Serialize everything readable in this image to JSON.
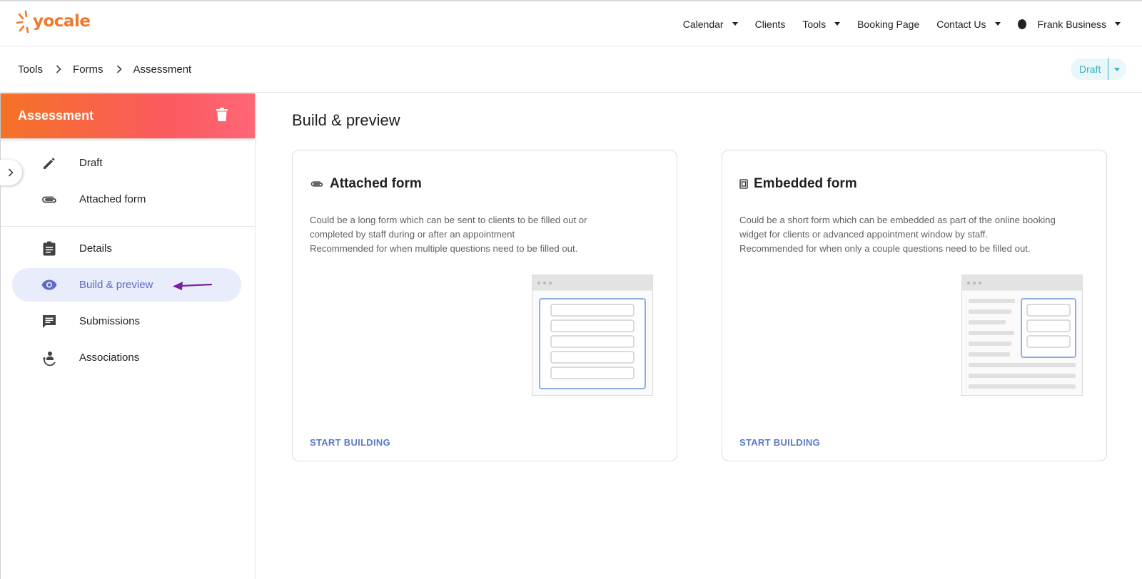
{
  "brand": {
    "name": "yocale",
    "color": "#f0782b"
  },
  "nav": {
    "items": [
      {
        "label": "Calendar",
        "dropdown": true
      },
      {
        "label": "Clients",
        "dropdown": false
      },
      {
        "label": "Tools",
        "dropdown": true
      },
      {
        "label": "Booking Page",
        "dropdown": false
      },
      {
        "label": "Contact Us",
        "dropdown": true
      }
    ],
    "user": "Frank Business"
  },
  "breadcrumb": [
    "Tools",
    "Forms",
    "Assessment"
  ],
  "status": {
    "label": "Draft",
    "color": "#35b3c4"
  },
  "sidebar": {
    "title": "Assessment",
    "top_items": [
      {
        "label": "Draft",
        "icon": "pencil-icon"
      },
      {
        "label": "Attached form",
        "icon": "paperclip-icon"
      }
    ],
    "items": [
      {
        "label": "Details",
        "icon": "clipboard-icon",
        "active": false
      },
      {
        "label": "Build & preview",
        "icon": "eye-icon",
        "active": true
      },
      {
        "label": "Submissions",
        "icon": "comment-icon",
        "active": false
      },
      {
        "label": "Associations",
        "icon": "associations-icon",
        "active": false
      }
    ],
    "active_color": "#5c6bc0"
  },
  "main": {
    "title": "Build & preview",
    "cards": [
      {
        "title": "Attached form",
        "icon": "paperclip-icon",
        "desc_lines": [
          "Could be a long form which can be sent to clients to be filled out or",
          "completed by staff during or after an appointment",
          "Recommended for when multiple questions need to be filled out."
        ],
        "action": "START BUILDING"
      },
      {
        "title": "Embedded form",
        "icon": "embed-icon",
        "desc_lines": [
          "Could be a short form which can be embedded as part of the online booking",
          "widget for clients or advanced appointment window by staff.",
          "Recommended for when only a couple questions need to be filled out."
        ],
        "action": "START BUILDING"
      }
    ]
  },
  "annotation": {
    "arrow_color": "#7b1fa2"
  }
}
